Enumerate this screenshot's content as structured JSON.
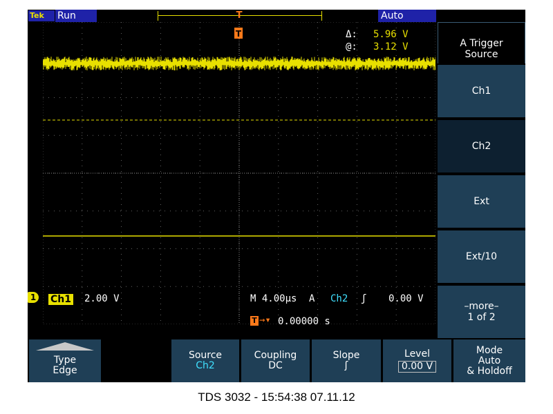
{
  "status": {
    "brand": "Tek",
    "run_state": "Run",
    "trigger_state": "Auto"
  },
  "cursor_readout": {
    "delta_label": "Δ:",
    "delta_value": "5.96 V",
    "at_label": "@:",
    "at_value": "3.12 V"
  },
  "channel": {
    "marker": "1",
    "name": "Ch1",
    "scale": "2.00 V"
  },
  "timebase": {
    "text": "M 4.00µs",
    "trigger_label": "A",
    "trigger_source": "Ch2",
    "trigger_level": "0.00 V",
    "position_text": "0.00000 s"
  },
  "side_menu": {
    "title_line1": "A Trigger",
    "title_line2": "Source",
    "items": [
      {
        "label": "Ch1",
        "selected": false
      },
      {
        "label": "Ch2",
        "selected": true
      },
      {
        "label": "Ext",
        "selected": false
      },
      {
        "label": "Ext/10",
        "selected": false
      },
      {
        "label": "–more–",
        "sub": "1 of 2",
        "selected": false
      }
    ]
  },
  "bottom_menu": {
    "type_label": "Type",
    "type_value": "Edge",
    "source_label": "Source",
    "source_value": "Ch2",
    "coupling_label": "Coupling",
    "coupling_value": "DC",
    "slope_label": "Slope",
    "slope_value": "╱",
    "level_label": "Level",
    "level_value": "0.00 V",
    "mode_line1": "Mode",
    "mode_line2": "Auto",
    "mode_line3": "& Holdoff"
  },
  "footer": "TDS 3032 - 15:54:38   07.11.12",
  "colors": {
    "trace": "#e8e000",
    "menu_bg": "#1f3f56",
    "menu_selected": "#0d2030",
    "accent_cyan": "#40e0ff",
    "trigger_marker": "#ff7a1a"
  }
}
